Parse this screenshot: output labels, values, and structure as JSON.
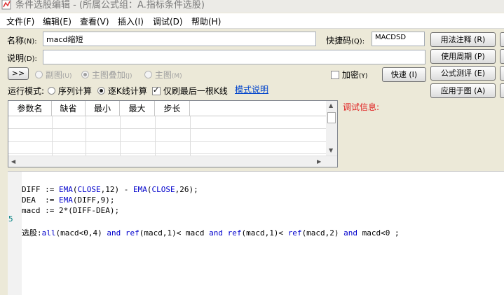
{
  "window": {
    "title": "条件选股编辑 - (所属公式组：A.指标条件选股)"
  },
  "menu": [
    "文件(F)",
    "编辑(E)",
    "查看(V)",
    "插入(I)",
    "调试(D)",
    "帮助(H)"
  ],
  "form": {
    "name_label": "名称",
    "name_hotkey": "(N):",
    "name_value": "macd缩短",
    "shortcut_label": "快捷码",
    "shortcut_hotkey": "(Q):",
    "shortcut_value": "MACDSD",
    "desc_label": "说明",
    "desc_hotkey": "(D):",
    "desc_value": "",
    "expand_button": ">>",
    "chart_options": [
      {
        "label": "副图",
        "hotkey": "(U)",
        "selected": false
      },
      {
        "label": "主图叠加",
        "hotkey": "(J)",
        "selected": true
      },
      {
        "label": "主图",
        "hotkey": "(M)",
        "selected": false
      }
    ],
    "encrypt_label": "加密",
    "encrypt_hotkey": "(Y)",
    "encrypt_checked": false,
    "quick_button": "快速 (I)",
    "run_mode_label": "运行模式:",
    "run_modes": [
      {
        "label": "序列计算",
        "selected": false
      },
      {
        "label": "逐K线计算",
        "selected": true
      }
    ],
    "last_bar_label": "仅刷最后一根K线",
    "last_bar_checked": true,
    "mode_help_link": "模式说明"
  },
  "right_buttons": [
    "用法注释 (R)",
    "使用周期 (P)",
    "公式测评 (E)",
    "应用于图 (A)"
  ],
  "debug": {
    "label": "调试信息:"
  },
  "param_table": {
    "columns": [
      "参数名",
      "缺省",
      "最小",
      "最大",
      "步长"
    ],
    "rows": []
  },
  "editor": {
    "line_number": "5",
    "lines": [
      "DIFF := EMA(CLOSE,12) - EMA(CLOSE,26);",
      "DEA  := EMA(DIFF,9);",
      "macd := 2*(DIFF-DEA);",
      "",
      "选股:all(macd<0,4) and ref(macd,1)< macd and ref(macd,1)< ref(macd,2) and macd<0 ;"
    ]
  }
}
